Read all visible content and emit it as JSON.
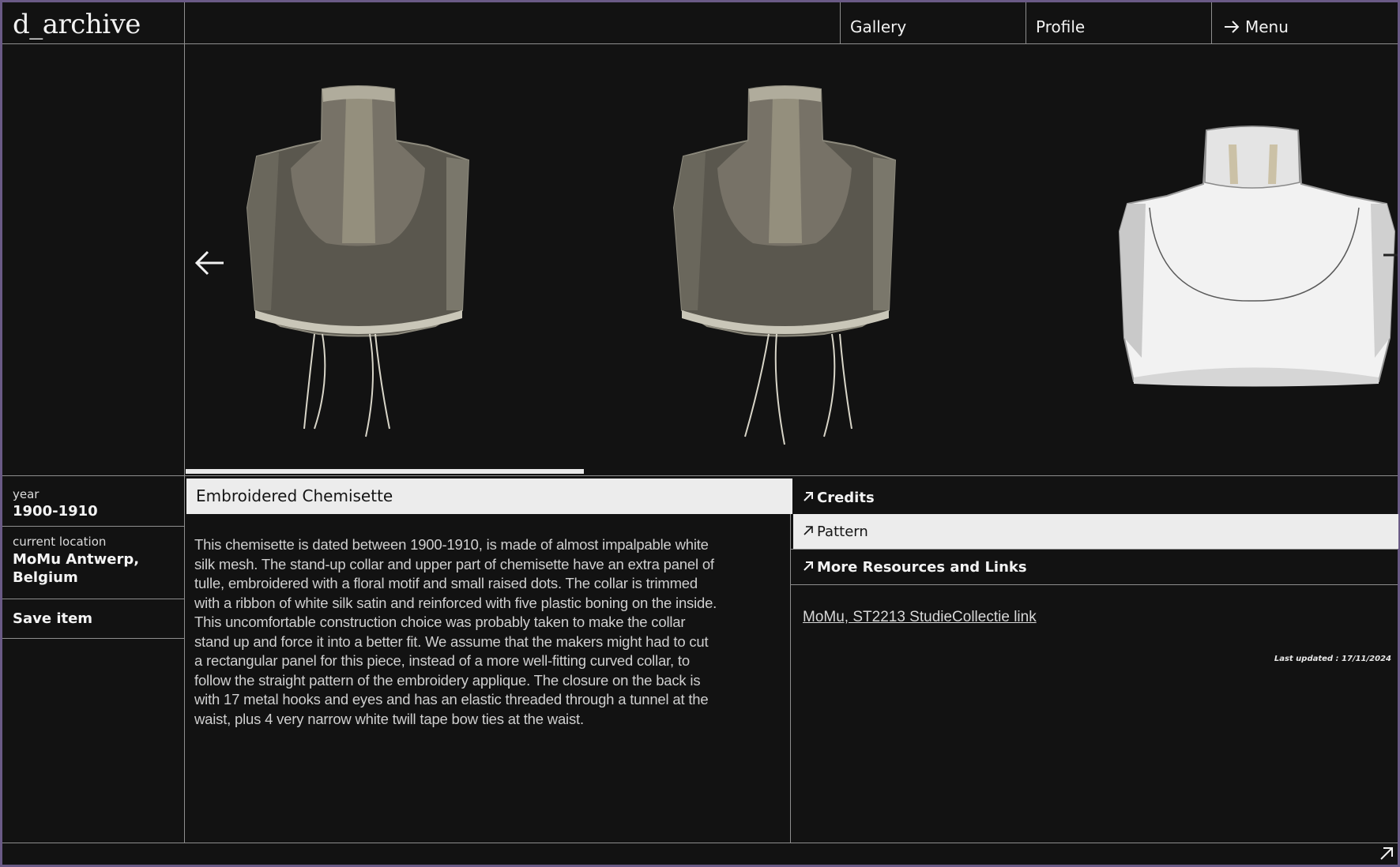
{
  "header": {
    "logo": "d_archive",
    "nav": {
      "gallery": "Gallery",
      "profile": "Profile",
      "menu": "Menu"
    }
  },
  "viewer": {
    "progress": 0.385,
    "views": [
      "front",
      "back",
      "3d-model"
    ]
  },
  "sidebar": {
    "year_label": "year",
    "year_value": "1900-1910",
    "location_label": "current location",
    "location_line1": "MoMu Antwerp,",
    "location_line2": "Belgium",
    "save_label": "Save item"
  },
  "item": {
    "title": "Embroidered Chemisette",
    "description": [
      "This chemisette is dated between 1900-1910, is made of almost impalpable white",
      "silk mesh. The stand-up collar and upper part of chemisette have an extra panel of",
      "tulle, embroidered with a floral motif and small raised dots. The collar is trimmed",
      "with a ribbon of white silk satin and reinforced with five plastic boning on the inside.",
      "This uncomfortable construction choice was probably taken to make the collar",
      "stand up and force it into a better fit. We assume that the makers might had to cut",
      "a rectangular panel for this piece, instead of a more well-fitting curved collar, to",
      "follow the straight pattern of the embroidery applique. The closure on the back is",
      "with 17 metal hooks and eyes and has an elastic threaded through a tunnel at the",
      "waist, plus 4 very narrow white twill tape bow ties at the waist."
    ]
  },
  "accordion": {
    "credits": "Credits",
    "pattern": "Pattern",
    "resources": "More Resources and Links",
    "active": "pattern"
  },
  "resources": {
    "link_text": "MoMu, ST2213 StudieCollectie link",
    "last_updated": "Last updated : 17/11/2024"
  },
  "colors": {
    "background": "#121212",
    "lines": "#8e8e8e",
    "highlight": "#ececec",
    "outer": "#6a5a86"
  }
}
